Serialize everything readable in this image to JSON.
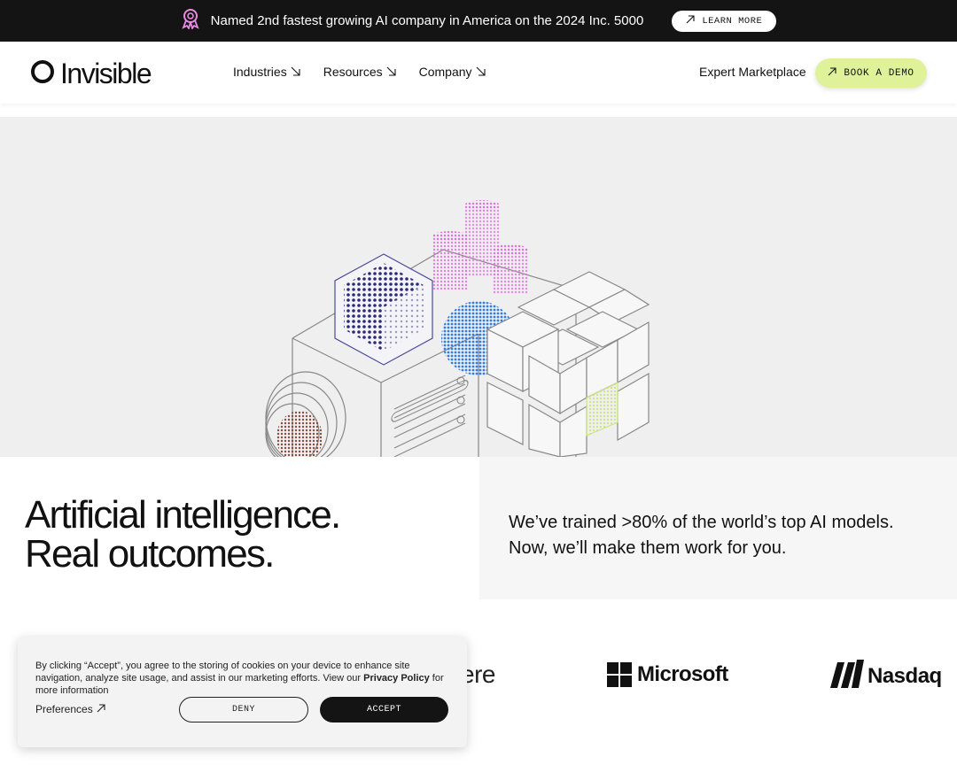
{
  "banner": {
    "text": "Named 2nd fastest growing AI company in America on the 2024 Inc. 5000",
    "button_label": "LEARN MORE",
    "icon": "award-ribbon-icon"
  },
  "nav": {
    "logo_text": "Invisible",
    "menu": [
      {
        "label": "Industries"
      },
      {
        "label": "Resources"
      },
      {
        "label": "Company"
      }
    ],
    "expert_label": "Expert Marketplace",
    "demo_label": "BOOK A DEMO"
  },
  "hero": {
    "headline_line1": "Artificial intelligence.",
    "headline_line2": "Real outcomes.",
    "sub_line1": "We’ve trained >80% of the world’s top AI models.",
    "sub_line2": "Now, we’ll make them work for you."
  },
  "logos": {
    "partial": "ere",
    "microsoft": "Microsoft",
    "nasdaq": "Nasdaq"
  },
  "cookie": {
    "text_before": "By clicking “Accept”, you agree to the storing of cookies on your device to enhance site navigation, analyze site usage, and assist in our marketing efforts. View our ",
    "policy_link": "Privacy Policy",
    "text_after": " for more information",
    "preferences_label": "Preferences",
    "deny_label": "DENY",
    "accept_label": "ACCEPT"
  },
  "colors": {
    "banner_bg": "#141414",
    "demo_button": "#dff29a",
    "hero_bg": "#efefef",
    "accent_pink": "#e46be4",
    "accent_blue": "#2f7de8",
    "accent_navy": "#2a2a7a"
  }
}
